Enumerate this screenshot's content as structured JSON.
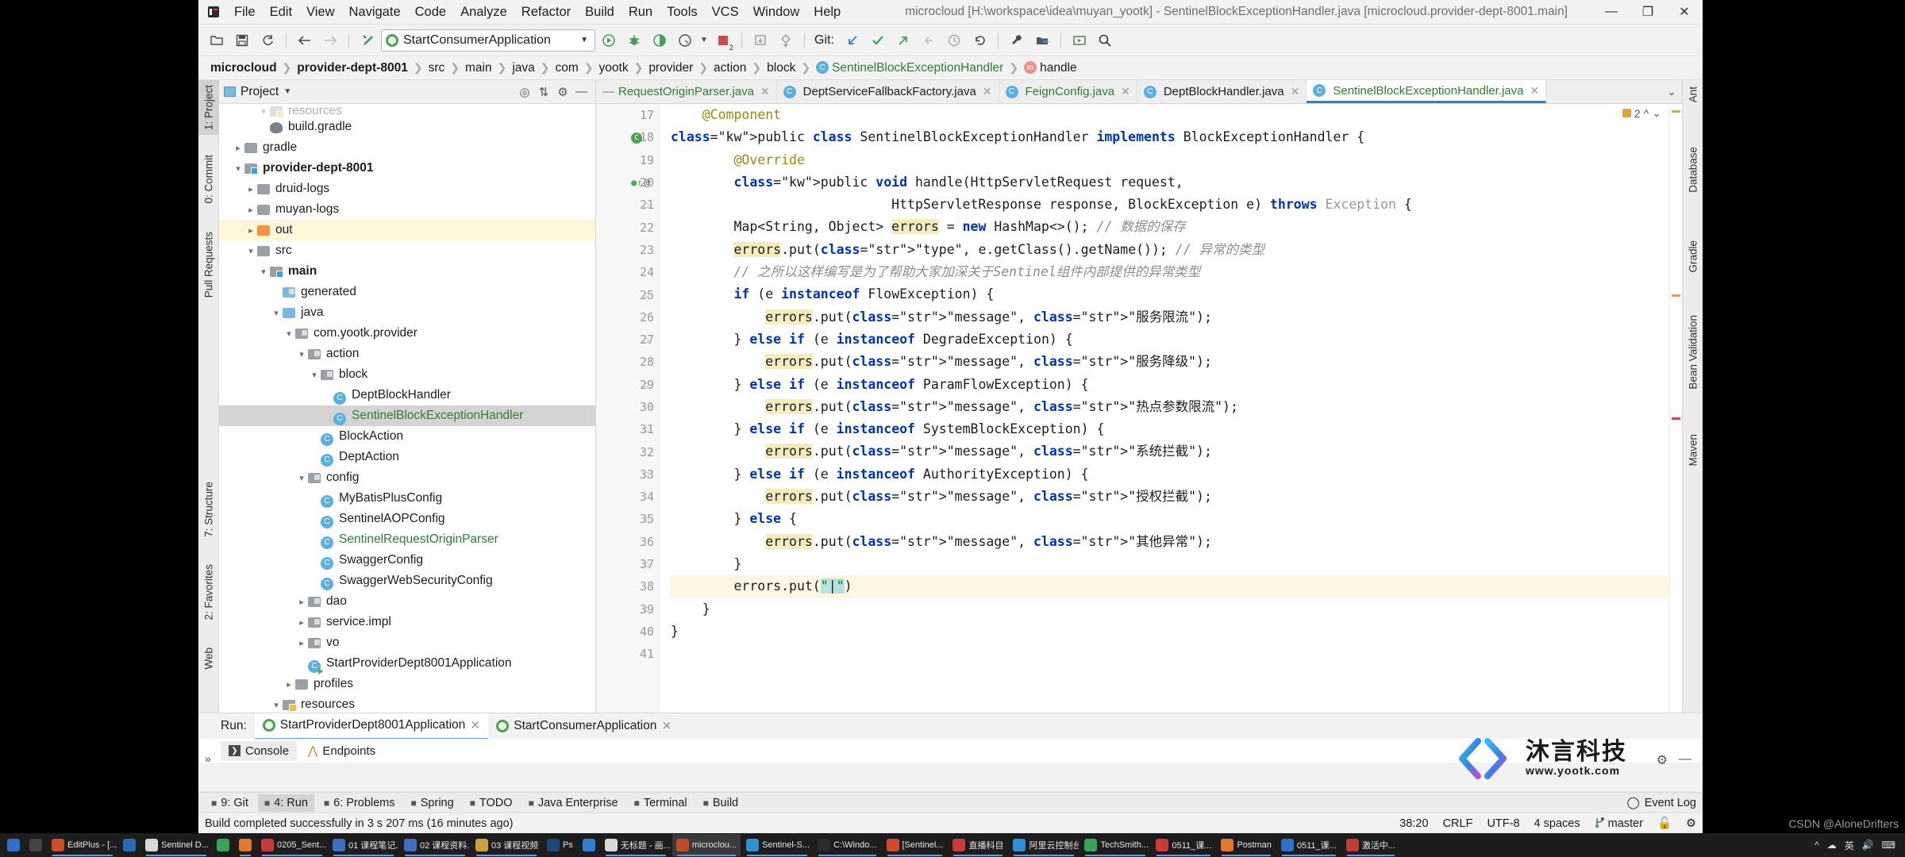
{
  "window": {
    "title": "microcloud [H:\\workspace\\idea\\muyan_yootk] - SentinelBlockExceptionHandler.java [microcloud.provider-dept-8001.main]",
    "minimize": "—",
    "maximize": "❐",
    "close": "✕"
  },
  "menu": [
    "File",
    "Edit",
    "View",
    "Navigate",
    "Code",
    "Analyze",
    "Refactor",
    "Build",
    "Run",
    "Tools",
    "VCS",
    "Window",
    "Help"
  ],
  "toolbar": {
    "run_config": "StartConsumerApplication",
    "git_label": "Git:",
    "error_count": "2"
  },
  "breadcrumb": [
    {
      "label": "microcloud",
      "bold": true,
      "icon": ""
    },
    {
      "label": "provider-dept-8001",
      "bold": true,
      "icon": ""
    },
    {
      "label": "src",
      "bold": false,
      "icon": ""
    },
    {
      "label": "main",
      "bold": false,
      "icon": ""
    },
    {
      "label": "java",
      "bold": false,
      "icon": ""
    },
    {
      "label": "com",
      "bold": false,
      "icon": ""
    },
    {
      "label": "yootk",
      "bold": false,
      "icon": ""
    },
    {
      "label": "provider",
      "bold": false,
      "icon": ""
    },
    {
      "label": "action",
      "bold": false,
      "icon": ""
    },
    {
      "label": "block",
      "bold": false,
      "icon": ""
    },
    {
      "label": "SentinelBlockExceptionHandler",
      "bold": false,
      "icon": "class-icon",
      "green": true
    },
    {
      "label": "handle",
      "bold": false,
      "icon": "method-icon"
    }
  ],
  "left_tool_strip": [
    "1: Project",
    "0: Commit",
    "Pull Requests",
    "7: Structure",
    "2: Favorites",
    "Web"
  ],
  "right_tool_strip": [
    "Ant",
    "Database",
    "Gradle",
    "Bean Validation",
    "Maven"
  ],
  "project": {
    "title": "Project",
    "tree": [
      {
        "label": "resources",
        "indent": 3,
        "icon": "folder-resources",
        "twisty": "v",
        "partial": true
      },
      {
        "label": "build.gradle",
        "indent": 3,
        "icon": "gradle-file",
        "twisty": ""
      },
      {
        "label": "gradle",
        "indent": 1,
        "icon": "folder",
        "twisty": ">"
      },
      {
        "label": "provider-dept-8001",
        "indent": 1,
        "icon": "folder-module",
        "twisty": "v",
        "bold": true
      },
      {
        "label": "druid-logs",
        "indent": 2,
        "icon": "folder",
        "twisty": ">"
      },
      {
        "label": "muyan-logs",
        "indent": 2,
        "icon": "folder",
        "twisty": ">"
      },
      {
        "label": "out",
        "indent": 2,
        "icon": "folder-excluded",
        "twisty": ">",
        "highlight": true
      },
      {
        "label": "src",
        "indent": 2,
        "icon": "folder",
        "twisty": "v"
      },
      {
        "label": "main",
        "indent": 3,
        "icon": "folder-module",
        "twisty": "v",
        "bold": true
      },
      {
        "label": "generated",
        "indent": 4,
        "icon": "folder-generated",
        "twisty": ""
      },
      {
        "label": "java",
        "indent": 4,
        "icon": "folder-source",
        "twisty": "v"
      },
      {
        "label": "com.yootk.provider",
        "indent": 5,
        "icon": "folder-package",
        "twisty": "v"
      },
      {
        "label": "action",
        "indent": 6,
        "icon": "folder-package",
        "twisty": "v"
      },
      {
        "label": "block",
        "indent": 7,
        "icon": "folder-package",
        "twisty": "v"
      },
      {
        "label": "DeptBlockHandler",
        "indent": 8,
        "icon": "class",
        "twisty": ""
      },
      {
        "label": "SentinelBlockExceptionHandler",
        "indent": 8,
        "icon": "class",
        "twisty": "",
        "selected": true,
        "green": true
      },
      {
        "label": "BlockAction",
        "indent": 7,
        "icon": "class",
        "twisty": ""
      },
      {
        "label": "DeptAction",
        "indent": 7,
        "icon": "class",
        "twisty": ""
      },
      {
        "label": "config",
        "indent": 6,
        "icon": "folder-package",
        "twisty": "v"
      },
      {
        "label": "MyBatisPlusConfig",
        "indent": 7,
        "icon": "class",
        "twisty": ""
      },
      {
        "label": "SentinelAOPConfig",
        "indent": 7,
        "icon": "class",
        "twisty": ""
      },
      {
        "label": "SentinelRequestOriginParser",
        "indent": 7,
        "icon": "class",
        "twisty": "",
        "green": true
      },
      {
        "label": "SwaggerConfig",
        "indent": 7,
        "icon": "class",
        "twisty": ""
      },
      {
        "label": "SwaggerWebSecurityConfig",
        "indent": 7,
        "icon": "class",
        "twisty": ""
      },
      {
        "label": "dao",
        "indent": 6,
        "icon": "folder-package",
        "twisty": ">"
      },
      {
        "label": "service.impl",
        "indent": 6,
        "icon": "folder-package",
        "twisty": ">"
      },
      {
        "label": "vo",
        "indent": 6,
        "icon": "folder-package",
        "twisty": ">"
      },
      {
        "label": "StartProviderDept8001Application",
        "indent": 6,
        "icon": "class-runnable",
        "twisty": ""
      },
      {
        "label": "profiles",
        "indent": 5,
        "icon": "folder",
        "twisty": ">"
      },
      {
        "label": "resources",
        "indent": 4,
        "icon": "folder-resources",
        "twisty": "v"
      }
    ]
  },
  "editor_tabs": [
    {
      "label": "RequestOriginParser.java",
      "icon": "dash",
      "green": true,
      "active": false
    },
    {
      "label": "DeptServiceFallbackFactory.java",
      "icon": "class",
      "green": false,
      "active": false
    },
    {
      "label": "FeignConfig.java",
      "icon": "class",
      "green": true,
      "active": false
    },
    {
      "label": "DeptBlockHandler.java",
      "icon": "class",
      "green": false,
      "active": false
    },
    {
      "label": "SentinelBlockExceptionHandler.java",
      "icon": "class",
      "green": true,
      "active": true
    }
  ],
  "editor": {
    "inspection_count": "2",
    "first_line": 17,
    "lines": [
      {
        "n": 17,
        "text": "@Component",
        "kind": "ann",
        "indent": 1
      },
      {
        "n": 18,
        "text": "public class SentinelBlockExceptionHandler implements BlockExceptionHandler {",
        "kind": "code",
        "indent": 0,
        "gutter": "class"
      },
      {
        "n": 19,
        "text": "@Override",
        "kind": "ann",
        "indent": 2
      },
      {
        "n": 20,
        "text": "public void handle(HttpServletRequest request,",
        "kind": "code",
        "indent": 2,
        "gutter": "override"
      },
      {
        "n": 21,
        "text": "HttpServletResponse response, BlockException e) throws Exception {",
        "kind": "code",
        "indent": 0,
        "gutter": "fold"
      },
      {
        "n": 22,
        "text": "Map<String, Object> errors = new HashMap<>(); // 数据的保存",
        "kind": "code",
        "indent": 0
      },
      {
        "n": 23,
        "text": "errors.put(\"type\", e.getClass().getName()); // 异常的类型",
        "kind": "code",
        "indent": 0
      },
      {
        "n": 24,
        "text": "// 之所以这样编写是为了帮助大家加深关于Sentinel组件内部提供的异常类型",
        "kind": "comment",
        "indent": 0
      },
      {
        "n": 25,
        "text": "if (e instanceof FlowException) {",
        "kind": "code",
        "indent": 0,
        "gutter": "fold"
      },
      {
        "n": 26,
        "text": "errors.put(\"message\", \"服务限流\");",
        "kind": "code",
        "indent": 0
      },
      {
        "n": 27,
        "text": "} else if (e instanceof DegradeException) {",
        "kind": "code",
        "indent": 0,
        "gutter": "fold"
      },
      {
        "n": 28,
        "text": "errors.put(\"message\", \"服务降级\");",
        "kind": "code",
        "indent": 0
      },
      {
        "n": 29,
        "text": "} else if (e instanceof ParamFlowException) {",
        "kind": "code",
        "indent": 0,
        "gutter": "fold"
      },
      {
        "n": 30,
        "text": "errors.put(\"message\", \"热点参数限流\");",
        "kind": "code",
        "indent": 0
      },
      {
        "n": 31,
        "text": "} else if (e instanceof SystemBlockException) {",
        "kind": "code",
        "indent": 0,
        "gutter": "fold"
      },
      {
        "n": 32,
        "text": "errors.put(\"message\", \"系统拦截\");",
        "kind": "code",
        "indent": 0
      },
      {
        "n": 33,
        "text": "} else if (e instanceof AuthorityException) {",
        "kind": "code",
        "indent": 0,
        "gutter": "fold"
      },
      {
        "n": 34,
        "text": "errors.put(\"message\", \"授权拦截\");",
        "kind": "code",
        "indent": 0
      },
      {
        "n": 35,
        "text": "} else {",
        "kind": "code",
        "indent": 0,
        "gutter": "fold"
      },
      {
        "n": 36,
        "text": "errors.put(\"message\", \"其他异常\");",
        "kind": "code",
        "indent": 0
      },
      {
        "n": 37,
        "text": "}",
        "kind": "code",
        "indent": 0,
        "gutter": "fold"
      },
      {
        "n": 38,
        "text": "errors.put(\"\")",
        "kind": "code",
        "indent": 0,
        "current": true
      },
      {
        "n": 39,
        "text": "}",
        "kind": "code",
        "indent": 0,
        "gutter": "fold"
      },
      {
        "n": 40,
        "text": "}",
        "kind": "code",
        "indent": 0
      },
      {
        "n": 41,
        "text": "",
        "kind": "code",
        "indent": 0
      }
    ]
  },
  "run_panel": {
    "label": "Run:",
    "tabs": [
      {
        "label": "StartProviderDept8001Application",
        "active": true
      },
      {
        "label": "StartConsumerApplication",
        "active": false
      }
    ],
    "subtabs": [
      {
        "label": "Console",
        "icon": "console-icon",
        "active": true
      },
      {
        "label": "Endpoints",
        "icon": "endpoints-icon",
        "active": false
      }
    ]
  },
  "logo": {
    "cn": "沐言科技",
    "en": "www.yootk.com"
  },
  "tool_strip_bottom": [
    {
      "label": "9: Git",
      "icon": "git-icon",
      "selected": false
    },
    {
      "label": "4: Run",
      "icon": "run-icon",
      "selected": true
    },
    {
      "label": "6: Problems",
      "icon": "problems-icon",
      "selected": false
    },
    {
      "label": "Spring",
      "icon": "spring-icon",
      "selected": false
    },
    {
      "label": "TODO",
      "icon": "todo-icon",
      "selected": false
    },
    {
      "label": "Java Enterprise",
      "icon": "javaee-icon",
      "selected": false
    },
    {
      "label": "Terminal",
      "icon": "terminal-icon",
      "selected": false
    },
    {
      "label": "Build",
      "icon": "build-icon",
      "selected": false
    }
  ],
  "event_log": "Event Log",
  "status": {
    "message": "Build completed successfully in 3 s 207 ms (16 minutes ago)",
    "caret": "38:20",
    "line_sep": "CRLF",
    "encoding": "UTF-8",
    "indent": "4 spaces",
    "branch": "master"
  },
  "taskbar": [
    {
      "label": "",
      "color": "#2f6fd0",
      "active": false
    },
    {
      "label": "",
      "color": "#444444",
      "active": false
    },
    {
      "label": "EditPlus - [...",
      "color": "#d04b2a",
      "active": false,
      "running": true
    },
    {
      "label": "",
      "color": "#2b6cb0",
      "active": false
    },
    {
      "label": "Sentinel D...",
      "color": "#d8d8d8",
      "active": false,
      "running": true
    },
    {
      "label": "",
      "color": "#3aa35a",
      "active": false
    },
    {
      "label": "",
      "color": "#e8762a",
      "active": false,
      "running": true
    },
    {
      "label": "0205_Sent...",
      "color": "#c73b3b",
      "active": false,
      "running": true
    },
    {
      "label": "01 课程笔记...",
      "color": "#3f6fbf",
      "active": false,
      "running": true
    },
    {
      "label": "02 课程资料...",
      "color": "#3f6fbf",
      "active": false,
      "running": true
    },
    {
      "label": "03 课程视频",
      "color": "#c7a23b",
      "active": false,
      "running": true
    },
    {
      "label": "Ps",
      "color": "#1b4a7a",
      "active": false
    },
    {
      "label": "",
      "color": "#2f7fd0",
      "active": false
    },
    {
      "label": "无标题 - 画...",
      "color": "#d8d8d8",
      "active": false,
      "running": true
    },
    {
      "label": "microclou...",
      "color": "#c24b2a",
      "active": true,
      "running": true
    },
    {
      "label": "Sentinel-S...",
      "color": "#2f8fd0",
      "active": false,
      "running": true
    },
    {
      "label": "C:\\Windo...",
      "color": "#2b2b2b",
      "active": false,
      "running": true
    },
    {
      "label": "[Sentinel...",
      "color": "#d04b2a",
      "active": false,
      "running": true
    },
    {
      "label": "直播科目",
      "color": "#c73b3b",
      "active": false,
      "running": true
    },
    {
      "label": "阿里云控制台...",
      "color": "#2f8fd0",
      "active": false,
      "running": true
    },
    {
      "label": "TechSmith...",
      "color": "#3aa35a",
      "active": false,
      "running": true
    },
    {
      "label": "0511_课...",
      "color": "#c73b3b",
      "active": false,
      "running": true
    },
    {
      "label": "Postman",
      "color": "#e8762a",
      "active": false,
      "running": true
    },
    {
      "label": "0511_课...",
      "color": "#2f6fd0",
      "active": false,
      "running": true
    },
    {
      "label": "激活中...",
      "color": "#c73b3b",
      "active": false,
      "running": true
    }
  ],
  "watermark": "CSDN @AloneDrifters"
}
